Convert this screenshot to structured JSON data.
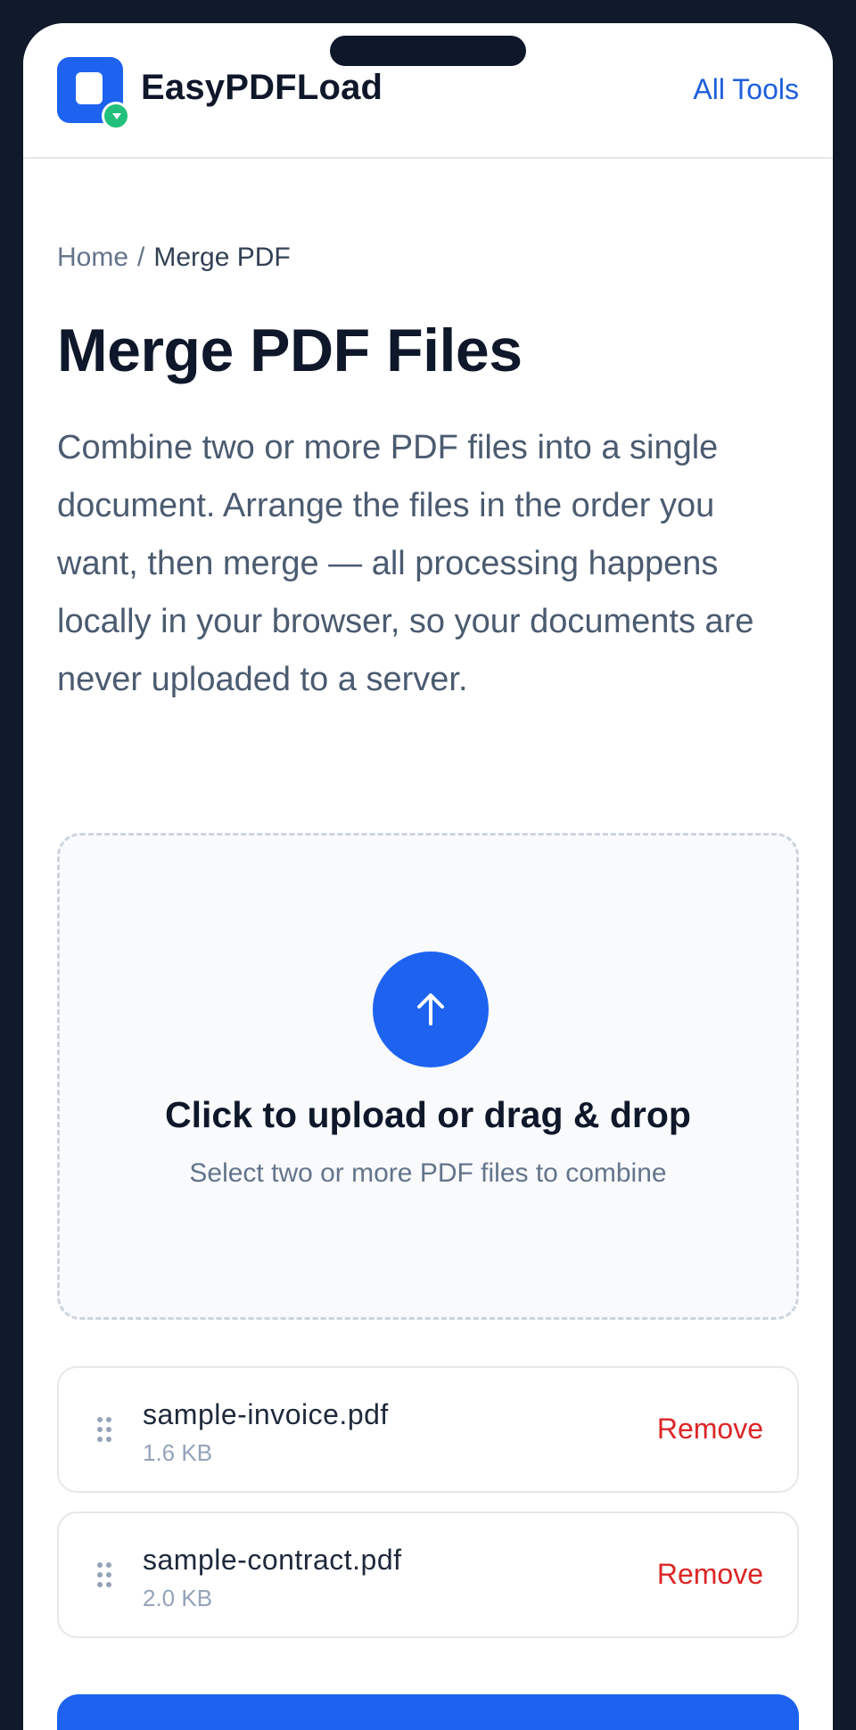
{
  "header": {
    "brand": "EasyPDFLoad",
    "nav_link": "All Tools"
  },
  "breadcrumb": {
    "home": "Home",
    "separator": "/",
    "current": "Merge PDF"
  },
  "page": {
    "title": "Merge PDF Files",
    "description": "Combine two or more PDF files into a single document. Arrange the files in the order you want, then merge — all processing happens locally in your browser, so your documents are never uploaded to a server."
  },
  "dropzone": {
    "title": "Click to upload or drag & drop",
    "subtitle": "Select two or more PDF files to combine",
    "icon": "arrow-up-icon"
  },
  "files": [
    {
      "name": "sample-invoice.pdf",
      "size": "1.6 KB",
      "remove_label": "Remove"
    },
    {
      "name": "sample-contract.pdf",
      "size": "2.0 KB",
      "remove_label": "Remove"
    }
  ],
  "colors": {
    "primary": "#1d63f0",
    "success": "#22c07a",
    "danger": "#dc2626",
    "frame": "#111a2b"
  }
}
